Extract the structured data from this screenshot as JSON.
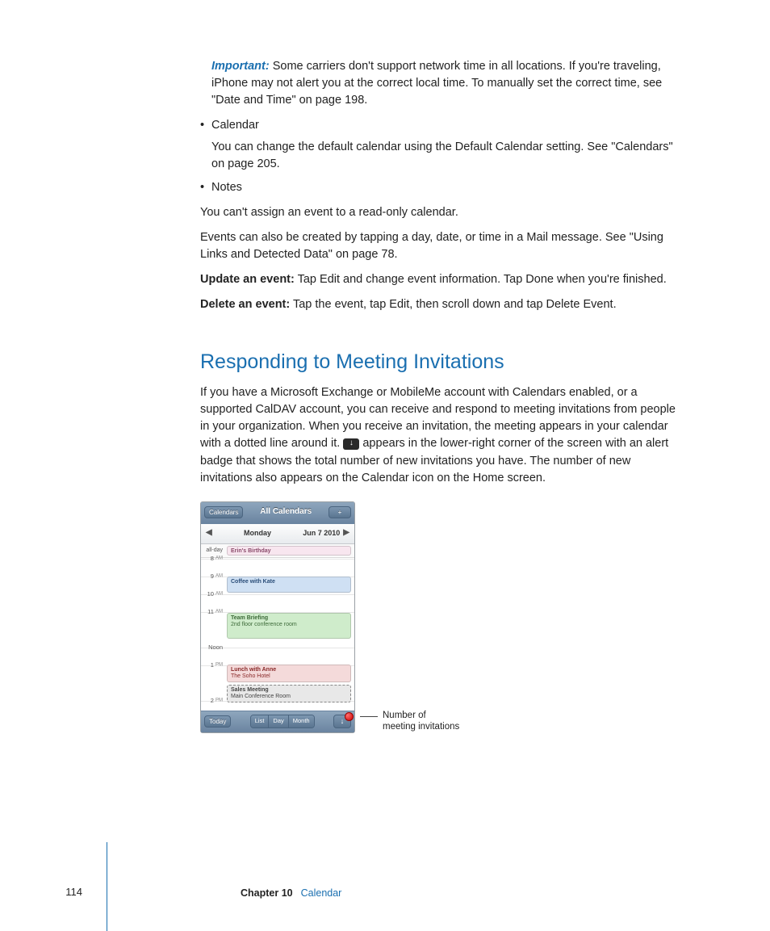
{
  "intro": {
    "important_label": "Important:",
    "important_text": "  Some carriers don't support network time in all locations. If you're traveling, iPhone may not alert you at the correct local time. To manually set the correct time, see \"Date and Time\" on page 198."
  },
  "bullets": {
    "calendar_label": "Calendar",
    "calendar_text": "You can change the default calendar using the Default Calendar setting. See \"Calendars\" on page 205.",
    "notes_label": "Notes"
  },
  "para_readonly": "You can't assign an event to a read-only calendar.",
  "para_events": "Events can also be created by tapping a day, date, or time in a Mail message. See \"Using Links and Detected Data\" on page 78.",
  "update_label": "Update an event:",
  "update_text": "  Tap Edit and change event information. Tap Done when you're finished.",
  "delete_label": "Delete an event:",
  "delete_text": "  Tap the event, tap Edit, then scroll down and tap Delete Event.",
  "section_title": "Responding to Meeting Invitations",
  "section_p_a": "If you have a Microsoft Exchange or MobileMe account with Calendars enabled, or a supported CalDAV account, you can receive and respond to meeting invitations from people in your organization. When you receive an invitation, the meeting appears in your calendar with a dotted line around it. ",
  "section_p_b": " appears in the lower-right corner of the screen with an alert badge that shows the total number of new invitations you have. The number of new invitations also appears on the Calendar icon on the Home screen.",
  "phone": {
    "back": "Calendars",
    "title": "All Calendars",
    "plus": "+",
    "day": "Monday",
    "date": "Jun 7 2010",
    "allday": "all-day",
    "hours": {
      "h8": "8",
      "h9": "9",
      "h10": "10",
      "h11": "11",
      "noon": "Noon",
      "h1": "1",
      "h2": "2"
    },
    "am": "AM",
    "pm": "PM",
    "ev_birthday": "Erin's Birthday",
    "ev_coffee": "Coffee with Kate",
    "ev_team_t": "Team Briefing",
    "ev_team_s": "2nd floor conference room",
    "ev_lunch_t": "Lunch with Anne",
    "ev_lunch_s": "The Soho Hotel",
    "ev_sales_t": "Sales Meeting",
    "ev_sales_s": "Main Conference Room",
    "today": "Today",
    "seg_list": "List",
    "seg_day": "Day",
    "seg_month": "Month"
  },
  "callout_l1": "Number of",
  "callout_l2": "meeting invitations",
  "footer": {
    "page": "114",
    "chapter_label": "Chapter 10",
    "chapter_title": "Calendar"
  }
}
